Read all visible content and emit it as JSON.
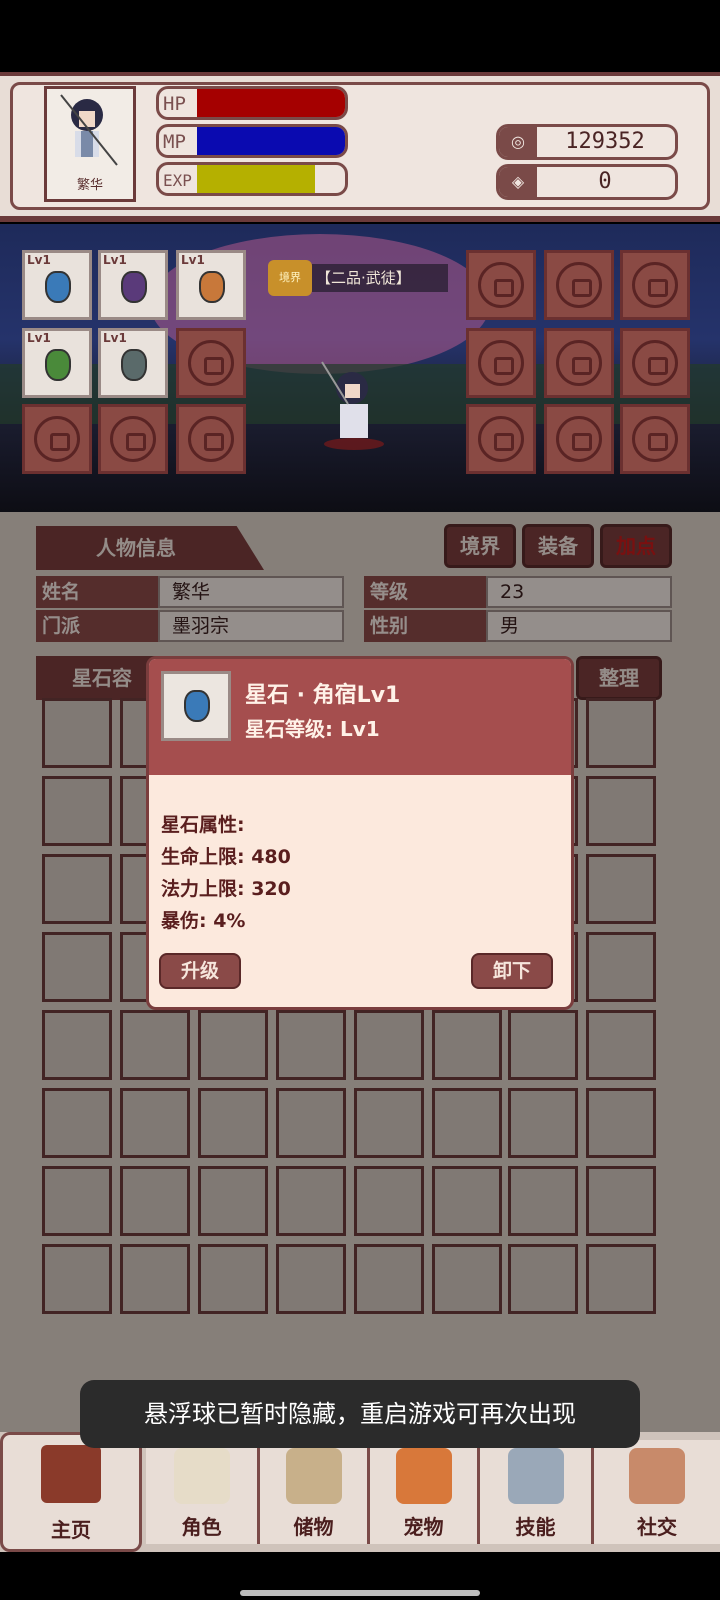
{
  "header": {
    "character_name": "繁华",
    "hp_label": "HP",
    "mp_label": "MP",
    "exp_label": "EXP",
    "hp_fill": 1.0,
    "mp_fill": 1.0,
    "exp_fill": 0.8,
    "coins": "129352",
    "gems": "0"
  },
  "scene": {
    "realm_badge": "境界",
    "realm_text": "【二品·武徒】",
    "left_slots": [
      {
        "level": "Lv1",
        "gem_color": "#3a7ab8"
      },
      {
        "level": "Lv1",
        "gem_color": "#5a3a7a"
      },
      {
        "level": "Lv1",
        "gem_color": "#c8783a"
      },
      {
        "level": "Lv1",
        "gem_color": "#4a8a3a"
      },
      {
        "level": "Lv1",
        "gem_color": "#5a6a6a"
      }
    ]
  },
  "tabs": {
    "section_title": "人物信息",
    "realm": "境界",
    "equip": "装备",
    "bonus": "加点"
  },
  "info": {
    "name_label": "姓名",
    "name_value": "繁华",
    "level_label": "等级",
    "level_value": "23",
    "sect_label": "门派",
    "sect_value": "墨羽宗",
    "gender_label": "性别",
    "gender_value": "男"
  },
  "container": {
    "title": "星石容",
    "sort_button": "整理"
  },
  "popup": {
    "title": "星石 · 角宿Lv1",
    "grade": "星石等级: Lv1",
    "attr_header": "星石属性:",
    "attr1": "生命上限: 480",
    "attr2": "法力上限: 320",
    "attr3": "暴伤: 4%",
    "upgrade_button": "升级",
    "unequip_button": "卸下"
  },
  "toast": "悬浮球已暂时隐藏，重启游戏可再次出现",
  "nav": {
    "home": "主页",
    "role": "角色",
    "storage": "储物",
    "pet": "宠物",
    "skill": "技能",
    "social": "社交"
  },
  "colors": {
    "hp": "#a50000",
    "mp": "#0a0ab0",
    "exp": "#b5b000",
    "accent": "#7a3d3d"
  }
}
